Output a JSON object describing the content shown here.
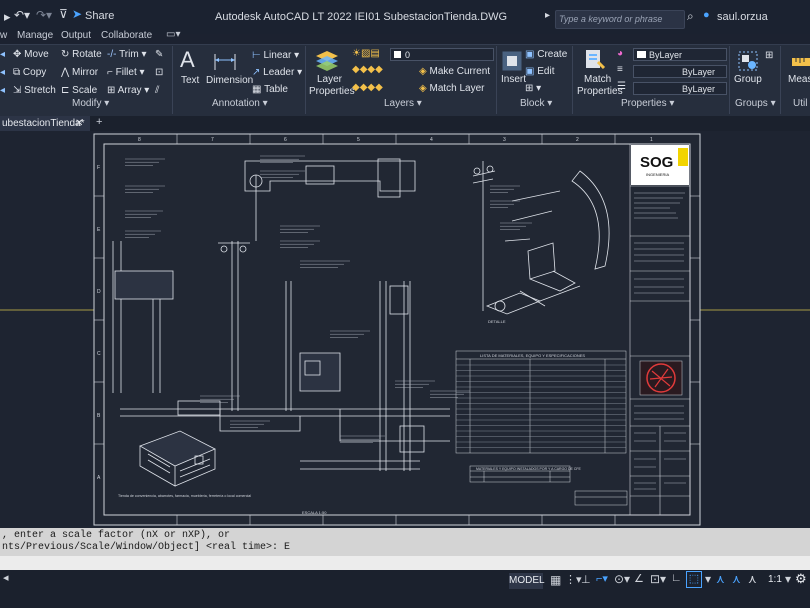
{
  "titlebar": {
    "share": "Share",
    "title": "Autodesk AutoCAD LT 2022   IEI01 SubestacionTienda.DWG",
    "search_placeholder": "Type a keyword or phrase",
    "user": "saul.orzua"
  },
  "ribbon_tabs": [
    "w",
    "Manage",
    "Output",
    "Collaborate"
  ],
  "ribbon": {
    "modify": {
      "move": "Move",
      "rotate": "Rotate",
      "trim": "Trim",
      "copy": "Copy",
      "mirror": "Mirror",
      "fillet": "Fillet",
      "stretch": "Stretch",
      "scale": "Scale",
      "array": "Array",
      "panel": "Modify"
    },
    "annotation": {
      "text": "Text",
      "dimension": "Dimension",
      "linear": "Linear",
      "leader": "Leader",
      "table": "Table",
      "panel": "Annotation"
    },
    "layers": {
      "layer_properties_1": "Layer",
      "layer_properties_2": "Properties",
      "layer_value": "0",
      "make_current": "Make Current",
      "match_layer": "Match Layer",
      "panel": "Layers"
    },
    "block": {
      "insert": "Insert",
      "create": "Create",
      "edit": "Edit",
      "panel": "Block"
    },
    "properties": {
      "match_1": "Match",
      "match_2": "Properties",
      "bylayer_1": "ByLayer",
      "bylayer_2": "ByLayer",
      "bylayer_3": "ByLayer",
      "panel": "Properties"
    },
    "groups": {
      "group": "Group",
      "panel": "Groups"
    },
    "utilities": {
      "measure": "Measu",
      "panel": "Util"
    }
  },
  "file_tab": {
    "name": "ubestacionTienda*",
    "new": "+"
  },
  "drawing": {
    "logo": "SOG",
    "logo_sub": "INGENIERIA",
    "materials_title": "LISTA DE MATERIALES, EQUIPO Y ESPECIFICACIONES",
    "materials2_title": "MATERIALES Y EQUIPO INSTALADOS POR Y A CARGO DE CFE",
    "detail_label": "DETALLE",
    "scale_label": "ESCALA 1:50",
    "box_caption": "Tienda de conveniencia, abarrotes, farmacia, mueblería, ferretería o local comercial",
    "col_numbers": [
      "8",
      "7",
      "6",
      "5",
      "4",
      "3",
      "2",
      "1"
    ],
    "row_letters": [
      "F",
      "E",
      "D",
      "C",
      "B",
      "A"
    ]
  },
  "command": {
    "line1": ", enter a scale factor (nX or nXP), or",
    "line2": "nts/Previous/Scale/Window/Object] <real time>: E"
  },
  "status": {
    "model": "MODEL",
    "scale": "1:1"
  },
  "colors": {
    "accent": "#4aa3ff",
    "title_bg": "#1b2230",
    "ribbon_bg": "#262e3d"
  }
}
